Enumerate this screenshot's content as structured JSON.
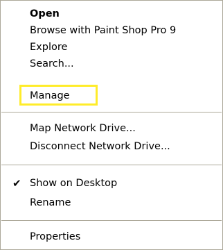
{
  "context_menu": {
    "items": [
      {
        "label": "Open",
        "bold": true
      },
      {
        "label": "Browse with Paint Shop Pro 9"
      },
      {
        "label": "Explore"
      },
      {
        "label": "Search..."
      },
      {
        "label": "Manage"
      },
      {
        "label": "Map Network Drive..."
      },
      {
        "label": "Disconnect Network Drive..."
      },
      {
        "label": "Show on Desktop",
        "checked": true,
        "check_glyph": "✔"
      },
      {
        "label": "Rename"
      },
      {
        "label": "Properties"
      }
    ],
    "highlight_color": "#ffec2a",
    "separator_color": "#aca899"
  }
}
